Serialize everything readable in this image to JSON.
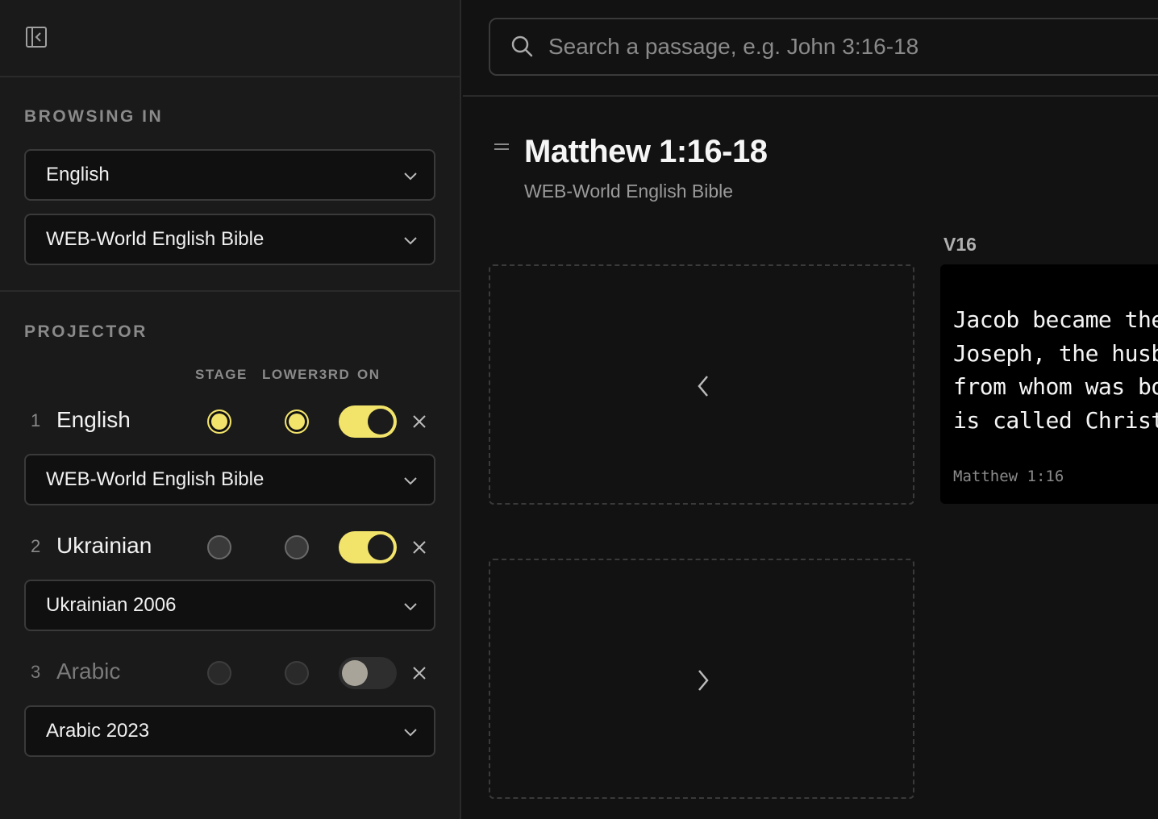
{
  "sidebar": {
    "browsing_label": "BROWSING IN",
    "language_select": "English",
    "version_select": "WEB-World English Bible",
    "projector_label": "PROJECTOR",
    "columns": {
      "stage": "STAGE",
      "lower3rd": "LOWER3RD",
      "on": "ON"
    },
    "projectors": [
      {
        "num": "1",
        "language": "English",
        "stage": true,
        "lower3rd": true,
        "on": true,
        "version": "WEB-World English Bible"
      },
      {
        "num": "2",
        "language": "Ukrainian",
        "stage": false,
        "lower3rd": false,
        "on": true,
        "version": "Ukrainian 2006"
      },
      {
        "num": "3",
        "language": "Arabic",
        "stage": false,
        "lower3rd": false,
        "on": false,
        "version": "Arabic 2023"
      }
    ]
  },
  "search": {
    "placeholder": "Search a passage, e.g. John 3:16-18"
  },
  "passage": {
    "title": "Matthew 1:16-18",
    "version": "WEB-World English Bible"
  },
  "verse": {
    "label": "V16",
    "text": "Jacob became the father of\nJoseph, the husband of Mary,\nfrom whom was born Jesus, who\nis called Christ.",
    "reference": "Matthew 1:16"
  },
  "colors": {
    "accent": "#f2e36b",
    "background": "#121212",
    "sidebar": "#1a1a1a"
  }
}
